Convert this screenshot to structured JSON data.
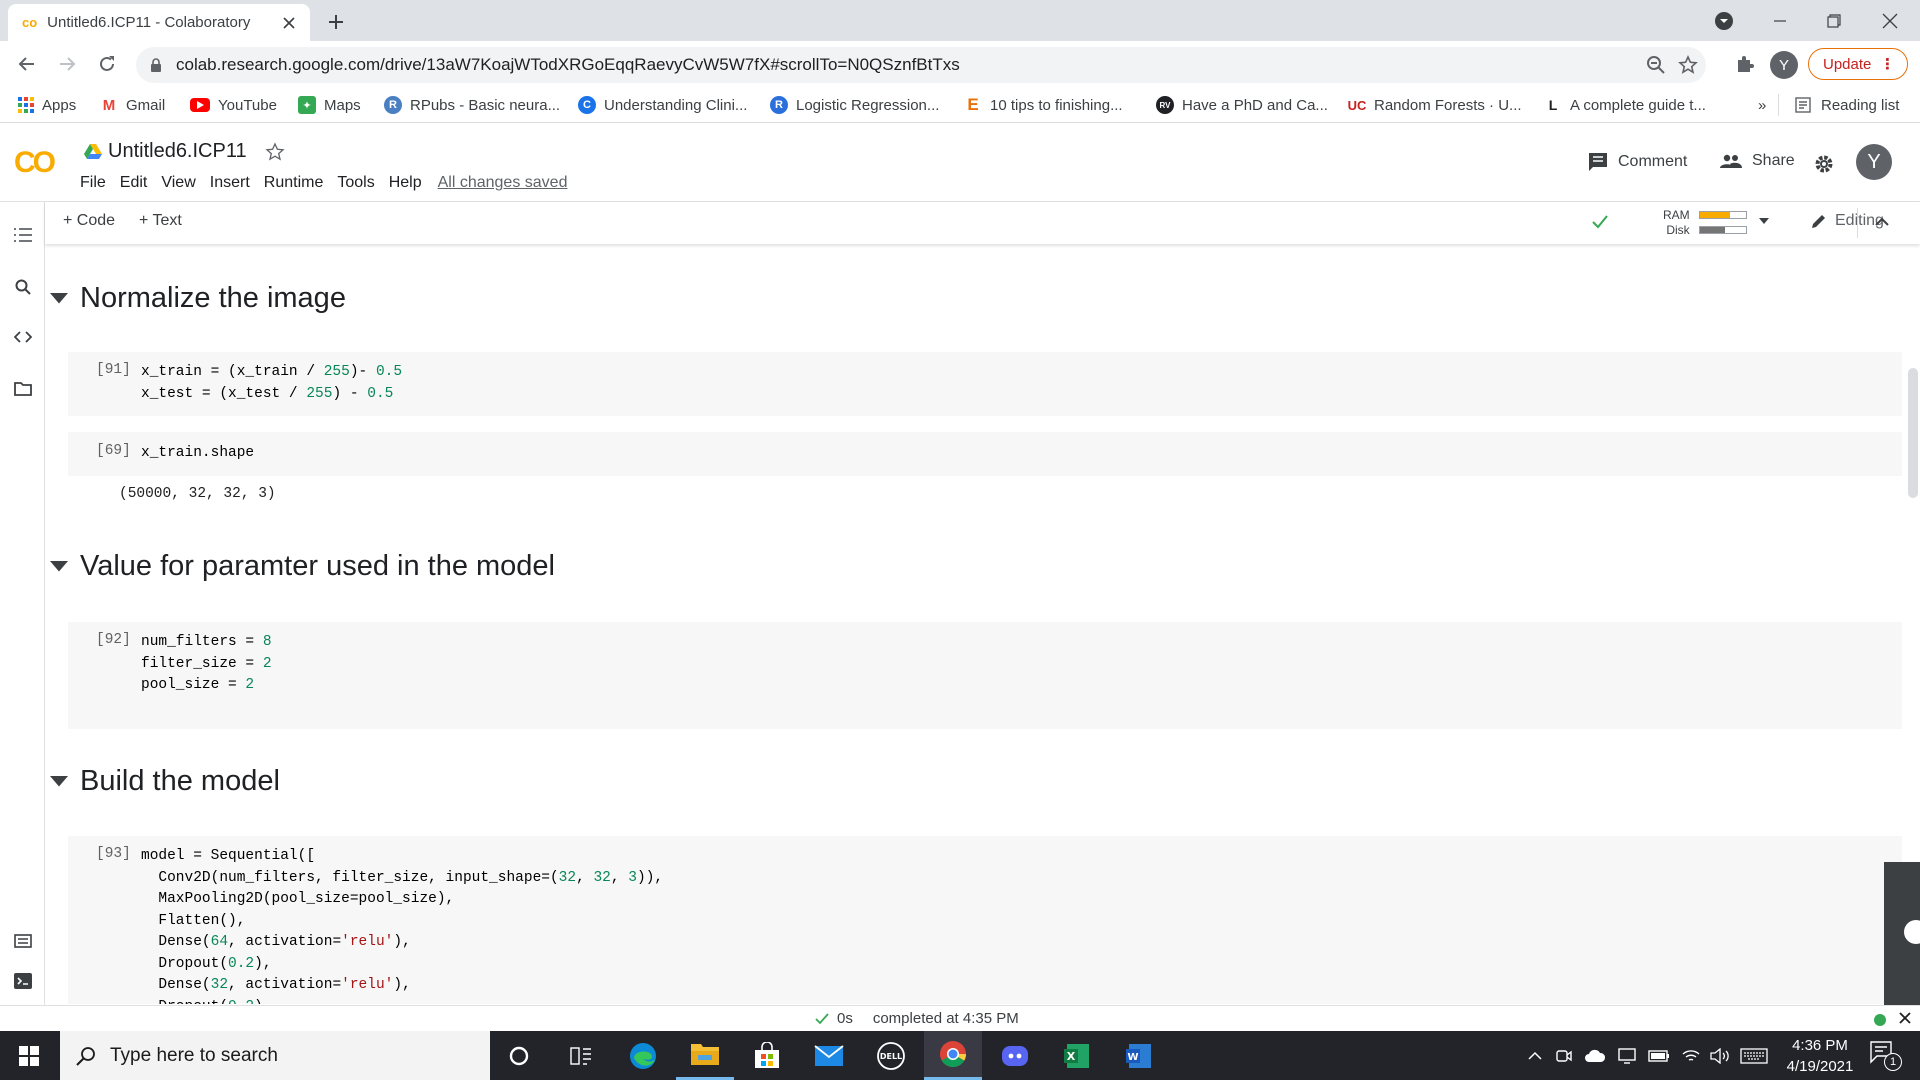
{
  "browser": {
    "tab_title": "Untitled6.ICP11 - Colaboratory",
    "url": "colab.research.google.com/drive/13aW7KoajWTodXRGoEqqRaevyCvW5W7fX#scrollTo=N0QSznfBtTxs",
    "update_label": "Update",
    "profile_initial": "Y"
  },
  "bookmarks": {
    "apps": "Apps",
    "items": [
      {
        "label": "Gmail",
        "icon": "gmail-icon"
      },
      {
        "label": "YouTube",
        "icon": "youtube-icon"
      },
      {
        "label": "Maps",
        "icon": "maps-icon"
      },
      {
        "label": "RPubs - Basic neura...",
        "icon": "rpubs-icon"
      },
      {
        "label": "Understanding Clini...",
        "icon": "c-icon"
      },
      {
        "label": "Logistic Regression...",
        "icon": "r-icon"
      },
      {
        "label": "10 tips to finishing...",
        "icon": "e-icon"
      },
      {
        "label": "Have a PhD and Ca...",
        "icon": "rv-icon"
      },
      {
        "label": "Random Forests · U...",
        "icon": "uc-icon"
      },
      {
        "label": "A complete guide t...",
        "icon": "l-icon"
      }
    ],
    "more": "»",
    "reading_list": "Reading list"
  },
  "colab": {
    "logo": "CO",
    "notebook_title": "Untitled6.ICP11",
    "menu": [
      "File",
      "Edit",
      "View",
      "Insert",
      "Runtime",
      "Tools",
      "Help"
    ],
    "save_status": "All changes saved",
    "comment": "Comment",
    "share": "Share",
    "avatar": "Y",
    "insert_code": "+ Code",
    "insert_text": "+ Text",
    "ram_label": "RAM",
    "disk_label": "Disk",
    "ram_usage": 0.65,
    "disk_usage": 0.55,
    "editing": "Editing"
  },
  "notebook": {
    "sections": [
      "Normalize the image",
      "Value for paramter used in the model",
      "Build the model"
    ],
    "cells": [
      {
        "exec": "[91]"
      },
      {
        "exec": "[69]",
        "output": "(50000, 32, 32, 3)"
      },
      {
        "exec": "[92]"
      },
      {
        "exec": "[93]"
      }
    ]
  },
  "status": {
    "time": "0s",
    "text": "completed at 4:35 PM"
  },
  "taskbar": {
    "search_placeholder": "Type here to search",
    "time": "4:36 PM",
    "date": "4/19/2021",
    "notification_count": "1"
  },
  "colors": {
    "colab_orange": "#f9ab00",
    "number": "#098658",
    "string": "#a31515",
    "update_border": "#e8710a"
  }
}
